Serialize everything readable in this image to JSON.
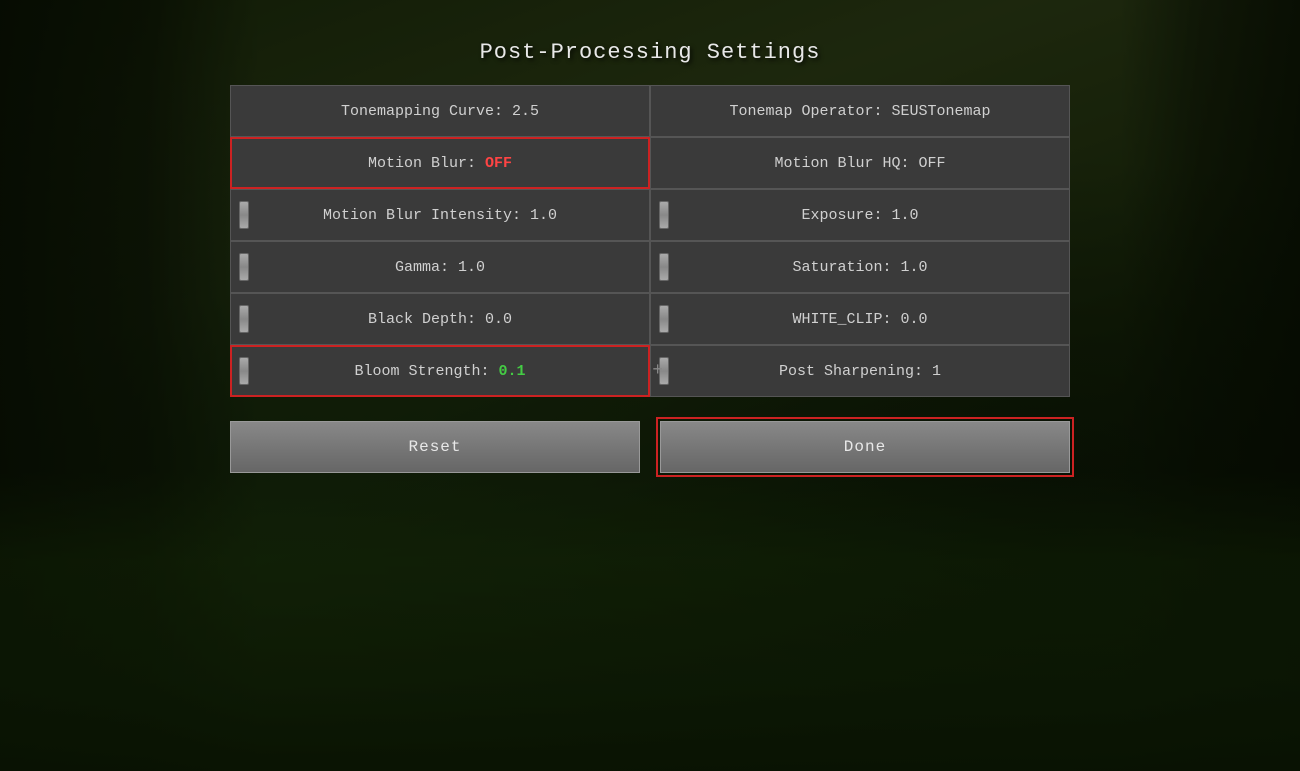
{
  "page": {
    "title": "Post-Processing Settings"
  },
  "settings": {
    "left_column": [
      {
        "id": "tonemapping-curve",
        "label": "Tonemapping Curve: 2.5",
        "highlighted": false,
        "has_left_slider": false,
        "has_right_slider": false,
        "value_type": "normal"
      },
      {
        "id": "motion-blur",
        "label": "Motion Blur: ",
        "value": "OFF",
        "highlighted": true,
        "has_left_slider": false,
        "has_right_slider": false,
        "value_type": "off"
      },
      {
        "id": "motion-blur-intensity",
        "label": "Motion Blur Intensity: 1.0",
        "highlighted": false,
        "has_left_slider": true,
        "has_right_slider": false,
        "value_type": "normal"
      },
      {
        "id": "gamma",
        "label": "Gamma: 1.0",
        "highlighted": false,
        "has_left_slider": true,
        "has_right_slider": false,
        "value_type": "normal"
      },
      {
        "id": "black-depth",
        "label": "Black Depth: 0.0",
        "highlighted": false,
        "has_left_slider": true,
        "has_right_slider": false,
        "value_type": "normal"
      },
      {
        "id": "bloom-strength",
        "label": "Bloom Strength: ",
        "value": "0.1",
        "highlighted": true,
        "has_left_slider": true,
        "has_right_slider": true,
        "value_type": "green"
      }
    ],
    "right_column": [
      {
        "id": "tonemap-operator",
        "label": "Tonemap Operator: SEUSTonemap",
        "highlighted": false,
        "has_left_slider": false,
        "value_type": "normal"
      },
      {
        "id": "motion-blur-hq",
        "label": "Motion Blur HQ: OFF",
        "highlighted": false,
        "has_left_slider": false,
        "value_type": "normal"
      },
      {
        "id": "exposure",
        "label": "Exposure: 1.0",
        "highlighted": false,
        "has_left_slider": true,
        "value_type": "normal"
      },
      {
        "id": "saturation",
        "label": "Saturation: 1.0",
        "highlighted": false,
        "has_left_slider": true,
        "value_type": "normal"
      },
      {
        "id": "white-clip",
        "label": "WHITE_CLIP: 0.0",
        "highlighted": false,
        "has_left_slider": true,
        "value_type": "normal"
      },
      {
        "id": "post-sharpening",
        "label": "Post Sharpening: 1",
        "highlighted": false,
        "has_left_slider": true,
        "value_type": "normal"
      }
    ]
  },
  "buttons": {
    "reset_label": "Reset",
    "done_label": "Done"
  }
}
